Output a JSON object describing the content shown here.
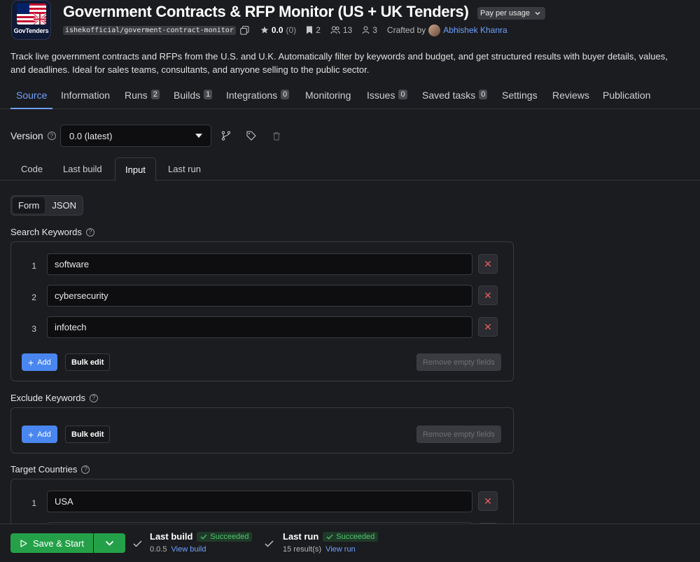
{
  "header": {
    "logo_text": "GovTenders",
    "title": "Government Contracts & RFP Monitor (US + UK Tenders)",
    "pricing": "Pay per usage",
    "slug": "ishekofficial/goverment-contract-monitor",
    "rating": "0.0",
    "rating_count": "(0)",
    "bookmarks": "2",
    "users": "13",
    "users_monthly": "3",
    "crafted_by_label": "Crafted by",
    "author": "Abhishek Khanra"
  },
  "description": "Track live government contracts and RFPs from the U.S. and U.K. Automatically filter by keywords and budget, and get structured results with buyer details, values, and deadlines. Ideal for sales teams, consultants, and anyone selling to the public sector.",
  "tabs": [
    {
      "label": "Source",
      "badge": ""
    },
    {
      "label": "Information",
      "badge": ""
    },
    {
      "label": "Runs",
      "badge": "2"
    },
    {
      "label": "Builds",
      "badge": "1"
    },
    {
      "label": "Integrations",
      "badge": "0"
    },
    {
      "label": "Monitoring",
      "badge": ""
    },
    {
      "label": "Issues",
      "badge": "0"
    },
    {
      "label": "Saved tasks",
      "badge": "0"
    },
    {
      "label": "Settings",
      "badge": ""
    },
    {
      "label": "Reviews",
      "badge": ""
    },
    {
      "label": "Publication",
      "badge": ""
    }
  ],
  "version": {
    "label": "Version",
    "value": "0.0 (latest)"
  },
  "subtabs": [
    "Code",
    "Last build",
    "Input",
    "Last run"
  ],
  "toggle": {
    "form": "Form",
    "json": "JSON"
  },
  "search_keywords": {
    "label": "Search Keywords",
    "items": [
      "software",
      "cybersecurity",
      "infotech"
    ],
    "add": "Add",
    "bulk_edit": "Bulk edit",
    "remove_empty": "Remove empty fields"
  },
  "exclude_keywords": {
    "label": "Exclude Keywords",
    "add": "Add",
    "bulk_edit": "Bulk edit",
    "remove_empty": "Remove empty fields"
  },
  "target_countries": {
    "label": "Target Countries",
    "items": [
      "USA"
    ]
  },
  "row_numbers": [
    "1",
    "2",
    "3"
  ],
  "bottom": {
    "save_start": "Save & Start",
    "last_build_title": "Last build",
    "last_build_status": "Succeeded",
    "last_build_version": "0.0.5",
    "view_build": "View build",
    "last_run_title": "Last run",
    "last_run_status": "Succeeded",
    "last_run_results": "15 result(s)",
    "view_run": "View run"
  },
  "colors": {
    "accent": "#6fa0ff",
    "success": "#24a148",
    "danger": "#e35d5d",
    "background": "#1b1c1f"
  }
}
